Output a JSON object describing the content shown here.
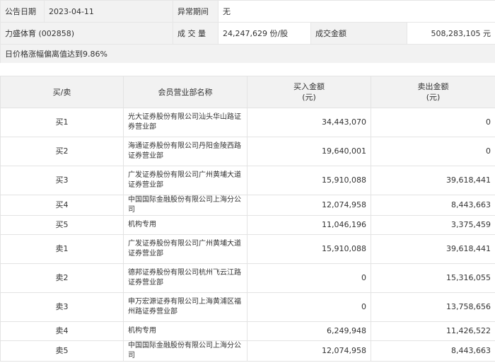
{
  "header": {
    "announce_date_label": "公告日期",
    "announce_date": "2023-04-11",
    "abnormal_period_label": "异常期间",
    "abnormal_period": "无",
    "stock_name": "力盛体育 (002858)",
    "volume_label": "成 交 量",
    "volume": "24,247,629 份/股",
    "amount_label": "成交金额",
    "amount": "508,283,105 元",
    "reason": "日价格涨幅偏离值达到9.86%"
  },
  "table": {
    "col_side": "买/卖",
    "col_dept": "会员营业部名称",
    "col_buy": "买入金额\n(元)",
    "col_sell": "卖出金额\n(元)",
    "rows": [
      {
        "side": "买1",
        "dept": "光大证券股份有限公司汕头华山路证券营业部",
        "buy": "34,443,070",
        "sell": "0"
      },
      {
        "side": "买2",
        "dept": "海通证券股份有限公司丹阳金陵西路证券营业部",
        "buy": "19,640,001",
        "sell": "0"
      },
      {
        "side": "买3",
        "dept": "广发证券股份有限公司广州黄埔大道证券营业部",
        "buy": "15,910,088",
        "sell": "39,618,441"
      },
      {
        "side": "买4",
        "dept": "中国国际金融股份有限公司上海分公司",
        "buy": "12,074,958",
        "sell": "8,443,663"
      },
      {
        "side": "买5",
        "dept": "机构专用",
        "buy": "11,046,196",
        "sell": "3,375,459"
      },
      {
        "side": "卖1",
        "dept": "广发证券股份有限公司广州黄埔大道证券营业部",
        "buy": "15,910,088",
        "sell": "39,618,441"
      },
      {
        "side": "卖2",
        "dept": "德邦证券股份有限公司杭州飞云江路证券营业部",
        "buy": "0",
        "sell": "15,316,055"
      },
      {
        "side": "卖3",
        "dept": "申万宏源证券有限公司上海黄浦区福州路证券营业部",
        "buy": "0",
        "sell": "13,758,656"
      },
      {
        "side": "卖4",
        "dept": "机构专用",
        "buy": "6,249,948",
        "sell": "11,426,522"
      },
      {
        "side": "卖5",
        "dept": "中国国际金融股份有限公司上海分公司",
        "buy": "12,074,958",
        "sell": "8,443,663"
      }
    ]
  }
}
